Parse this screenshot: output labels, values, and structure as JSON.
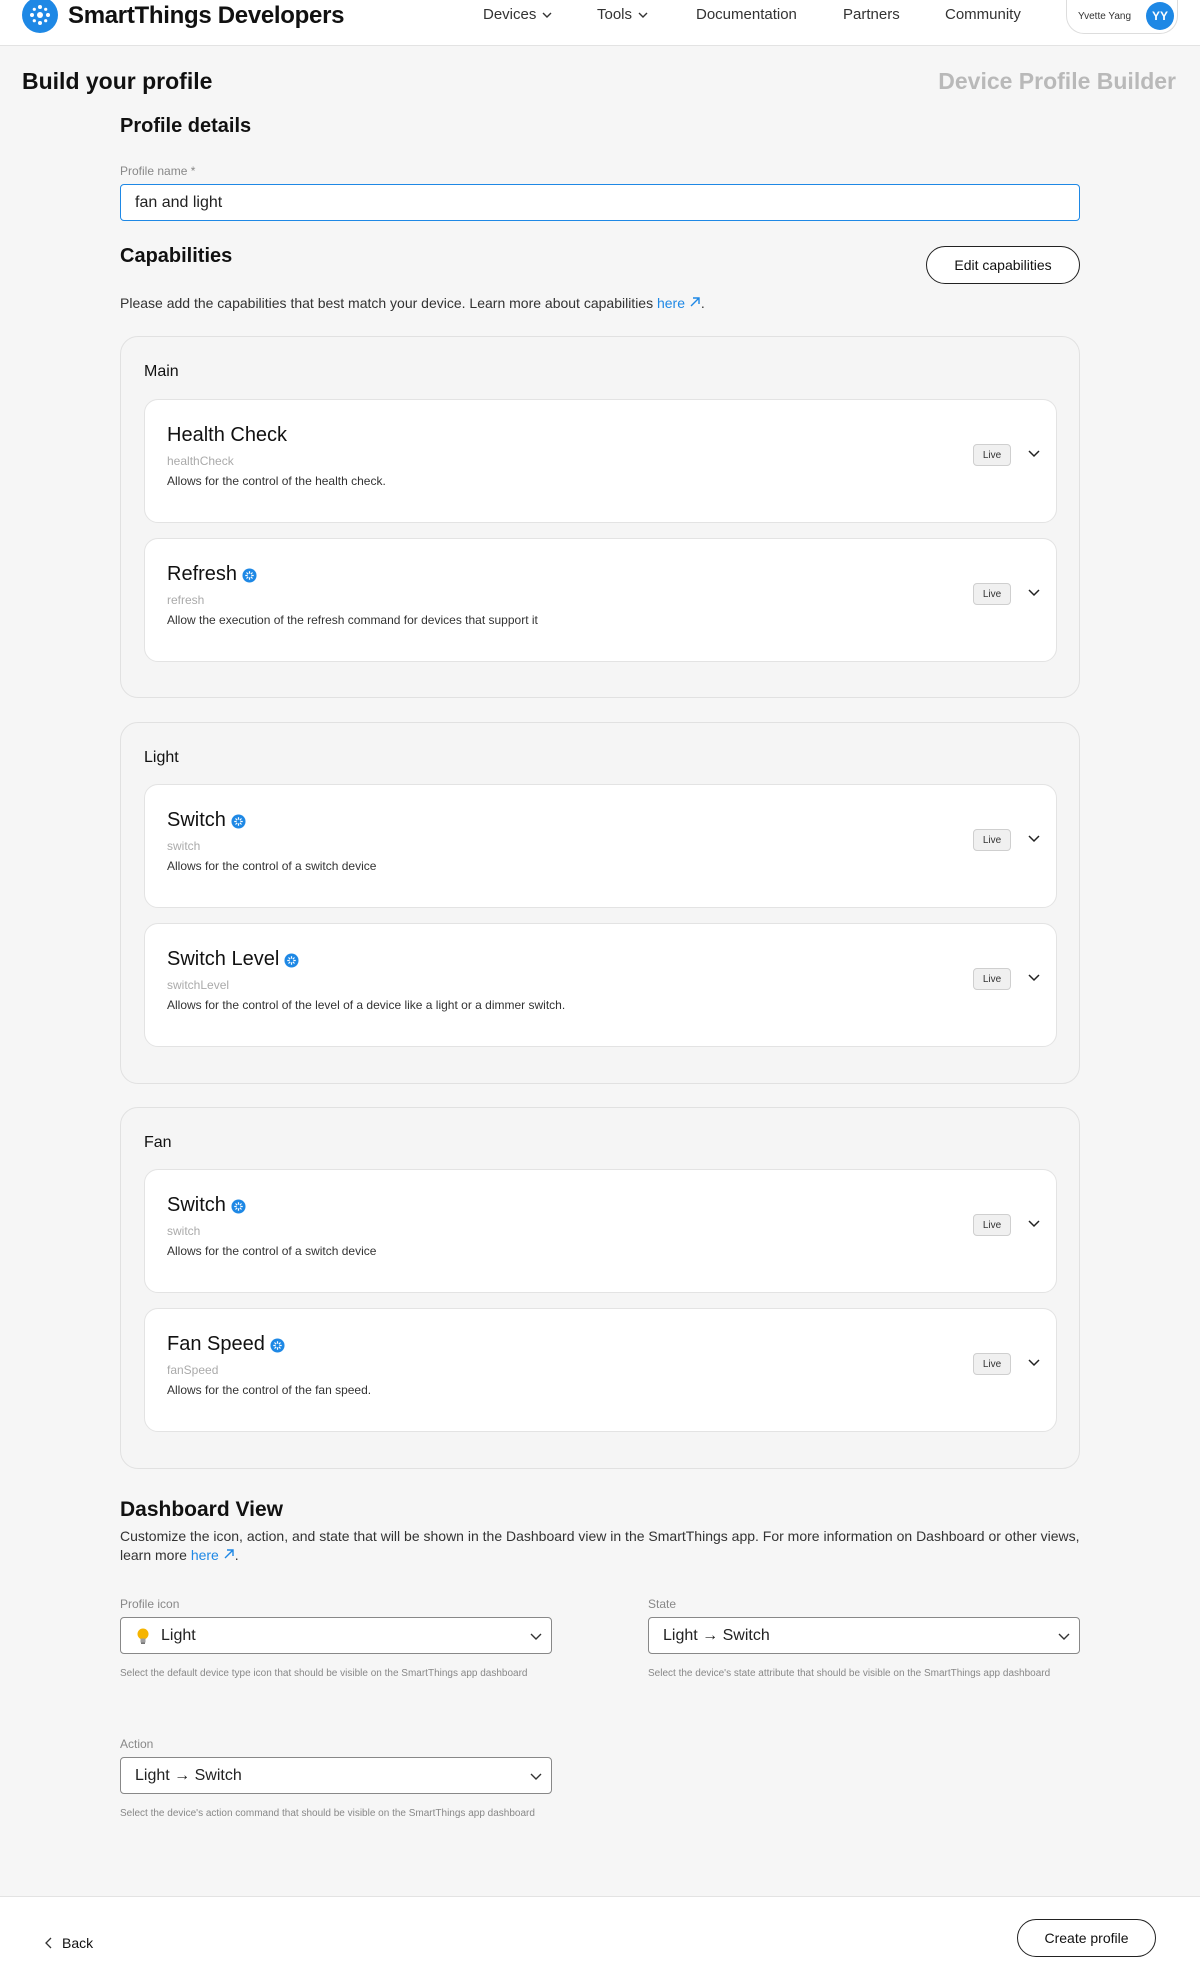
{
  "nav": {
    "brand": "SmartThings Developers",
    "items": [
      "Devices",
      "Tools",
      "Documentation",
      "Partners",
      "Community"
    ],
    "user_name": "Yvette Yang",
    "user_initials": "YY"
  },
  "page": {
    "title": "Build your profile",
    "builder_title": "Device Profile Builder"
  },
  "profile_details": {
    "title": "Profile details",
    "name_label": "Profile name *",
    "name_value": "fan and light"
  },
  "capabilities": {
    "title": "Capabilities",
    "edit_button": "Edit capabilities",
    "description": "Please add the capabilities that best match your device. Learn more about capabilities ",
    "link": "here",
    "period": ".",
    "live_label": "Live",
    "groups": [
      {
        "name": "Main",
        "items": [
          {
            "title": "Health Check",
            "id": "healthCheck",
            "desc": "Allows for the control of the health check.",
            "badge": false
          },
          {
            "title": "Refresh",
            "id": "refresh",
            "desc": "Allow the execution of the refresh command for devices that support it",
            "badge": true
          }
        ]
      },
      {
        "name": "Light",
        "items": [
          {
            "title": "Switch",
            "id": "switch",
            "desc": "Allows for the control of a switch device",
            "badge": true
          },
          {
            "title": "Switch Level",
            "id": "switchLevel",
            "desc": "Allows for the control of the level of a device like a light or a dimmer switch.",
            "badge": true
          }
        ]
      },
      {
        "name": "Fan",
        "items": [
          {
            "title": "Switch",
            "id": "switch",
            "desc": "Allows for the control of a switch device",
            "badge": true
          },
          {
            "title": "Fan Speed",
            "id": "fanSpeed",
            "desc": "Allows for the control of the fan speed.",
            "badge": true
          }
        ]
      }
    ]
  },
  "dashboard": {
    "title": "Dashboard View",
    "desc": "Customize the icon, action, and state that will be shown in the Dashboard view in the SmartThings app. For more information on Dashboard or other views, learn more ",
    "link": "here",
    "period": ".",
    "icon_label": "Profile icon",
    "icon_value": "Light",
    "icon_help": "Select the default device type icon that should be visible on the SmartThings app dashboard",
    "state_label": "State",
    "state_value": "Light → Switch",
    "state_help": "Select the device's state attribute that should be visible on the SmartThings app dashboard",
    "action_label": "Action",
    "action_value": "Light → Switch",
    "action_help": "Select the device's action command that should be visible on the SmartThings app dashboard"
  },
  "footer": {
    "back": "Back",
    "create": "Create profile"
  },
  "colors": {
    "accent": "#1e88e5",
    "background": "#f6f6f6"
  }
}
